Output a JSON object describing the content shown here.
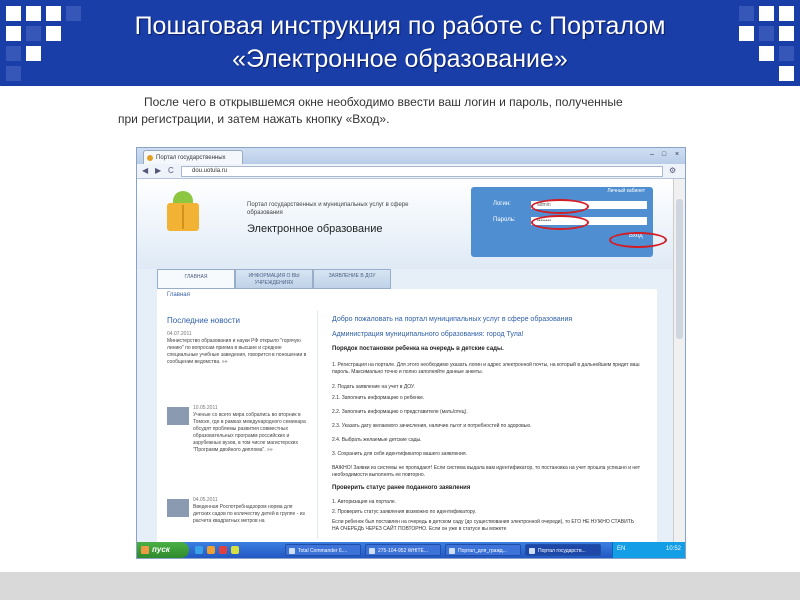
{
  "slide": {
    "title_line1": "Пошаговая инструкция по работе с Порталом",
    "title_line2": "«Электронное образование»",
    "instruction_line1": "После чего в открывшемся окне необходимо ввести ваш логин и пароль, полученные",
    "instruction_line2": "при регистрации, и затем нажать кнопку «Вход».",
    "header_color": "#1a3ea8",
    "highlight_color": "#d31c24"
  },
  "browser": {
    "tab_title": "Портал государственных",
    "url": "dou.uotula.ru",
    "win_min": "–",
    "win_max": "□",
    "win_close": "×",
    "back": "◀",
    "forward": "▶",
    "reload": "C",
    "wrench": "⚙"
  },
  "site": {
    "tagline": "Портал государственных и муниципальных услуг в сфере образования",
    "name": "Электронное образование",
    "login_panel": {
      "title": "Личный кабинет",
      "login_label": "Логин:",
      "login_value": "admin",
      "password_label": "Пароль:",
      "password_value": "••••••••",
      "submit": "Вход"
    },
    "nav": [
      {
        "label": "ГЛАВНАЯ"
      },
      {
        "label": "ИНФОРМАЦИЯ О ВЫ УЧРЕЖДЕНИЯХ"
      },
      {
        "label": "ЗАЯВЛЕНИЕ В ДОУ"
      }
    ],
    "breadcrumb": "Главная",
    "news": {
      "heading": "Последние новости",
      "items": [
        {
          "date": "04.07.2011",
          "text": "Министерство образования и науки РФ открыло \"горячую линию\" по вопросам приема в высшие и средние специальные учебные заведения, говорится в поношении в сообщении ведомства. »»"
        },
        {
          "date": "10.05.2011",
          "text": "Ученые со всего мира собрались во вторник в Томске, где в рамках международного семинара обсудят проблемы развития совместных образовательных программ российских и зарубежных вузов, в том числе магистерских \"Программ двойного диплома\". »»"
        },
        {
          "date": "04.05.2011",
          "text": "Введенная Роспотребнадзором норма для детских садов по количеству детей в группе - из расчета квадратных метров на"
        }
      ]
    },
    "welcome": "Добро пожаловать на портал муниципальных услуг в сфере образования",
    "admin": "Администрация муниципального образования: город Тула!",
    "order_heading": "Порядок постановки ребенка на очередь в детские сады.",
    "steps": [
      "1.  Регистрация на портале. Для этого необходимо указать логин и адрес электронной почты, на который в дальнейшем придет ваш пароль. Максимально точно и полно заполняйте данные анкеты.",
      "2.  Подать заявление на учет в ДОУ.",
      "2.1.  Заполнить информацию о ребенке.",
      "2.2.  Заполнить информацию о представителе (мать/отец).",
      "2.3.  Указать дату желаемого зачисления, наличие льгот и потребностей по здоровью.",
      "2.4.  Выбрать желаемые детские сады.",
      "3.  Сохранить для себя идентификатор вашего заявления.",
      "ВАЖНО! Заявки из системы не пропадают! Если система выдала вам идентификатор, то постановка на учет прошла успешно и нет необходимости выполнять ее повторно."
    ],
    "check_heading": "Проверить статус ранее поданного заявления",
    "check_steps": [
      "1.  Авторизация на портале.",
      "2.  Проверить статус заявления возможно по идентификатору.",
      "Если ребенок был поставлен на очередь в детском саду (до существования электронной очереди), то ЕГО НЕ НУЖНО СТАВИТЬ НА ОЧЕРЕДЬ ЧЕРЕЗ САЙТ ПОВТОРНО. Если он уже в статусе вы можете"
    ]
  },
  "taskbar": {
    "start": "пуск",
    "items": [
      "Total Commander 6....",
      "275-104-952 WHITE...",
      "Портал_для_гражд...",
      "Портал государств..."
    ],
    "lang": "EN",
    "clock": "10:52"
  }
}
